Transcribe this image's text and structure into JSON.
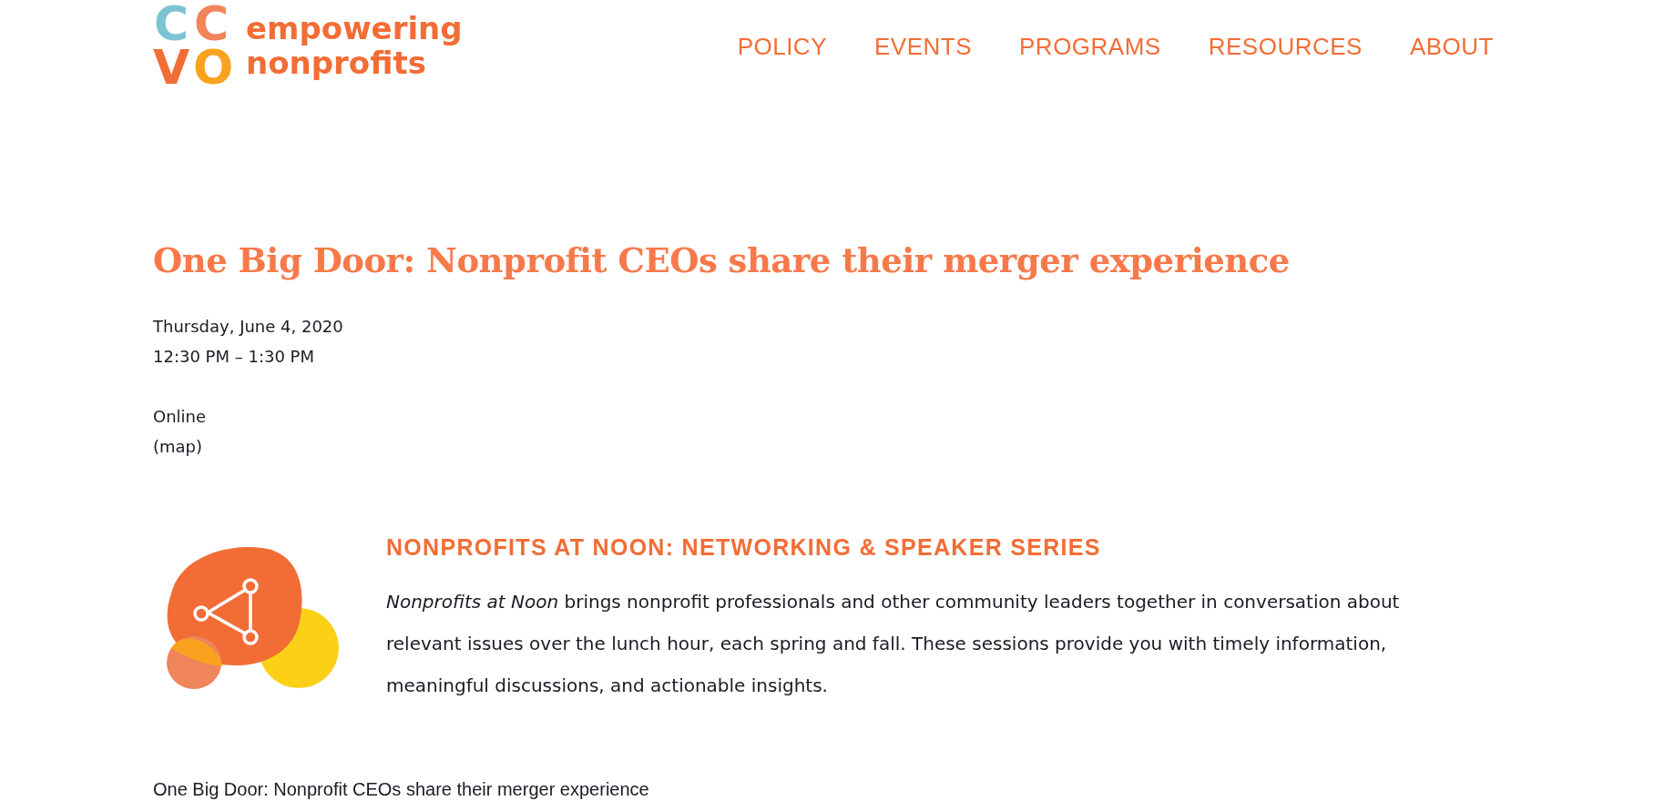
{
  "header": {
    "logo_letters": [
      {
        "text": "C",
        "color": "#7cc3d3"
      },
      {
        "text": "C",
        "color": "#f0845a"
      },
      {
        "text": "V",
        "color": "#f26d35"
      },
      {
        "text": "O",
        "color": "#f9a21f"
      }
    ],
    "tagline": [
      "empowering",
      "nonprofits"
    ],
    "nav": [
      {
        "label": "POLICY",
        "selected": false
      },
      {
        "label": "EVENTS",
        "selected": false
      },
      {
        "label": "PROGRAMS",
        "selected": false
      },
      {
        "label": "RESOURCES",
        "selected": false
      },
      {
        "label": "ABOUT",
        "selected": false
      }
    ]
  },
  "event": {
    "title": "One Big Door: Nonprofit CEOs share their merger experience",
    "date": "Thursday, June 4, 2020",
    "time": "12:30 PM – 1:30 PM",
    "location": "Online",
    "map_link": "(map)"
  },
  "series": {
    "heading": "NONPROFITS AT NOON: NETWORKING & SPEAKER SERIES",
    "description": "*Nonprofits at Noon* brings nonprofit professionals and other community leaders together in conversation about relevant issues over the lunch hour, each spring and fall. These sessions provide you with timely information, meaningful discussions, and actionable insights."
  },
  "subheading": "One Big Door: Nonprofit CEOs share their merger experience"
}
